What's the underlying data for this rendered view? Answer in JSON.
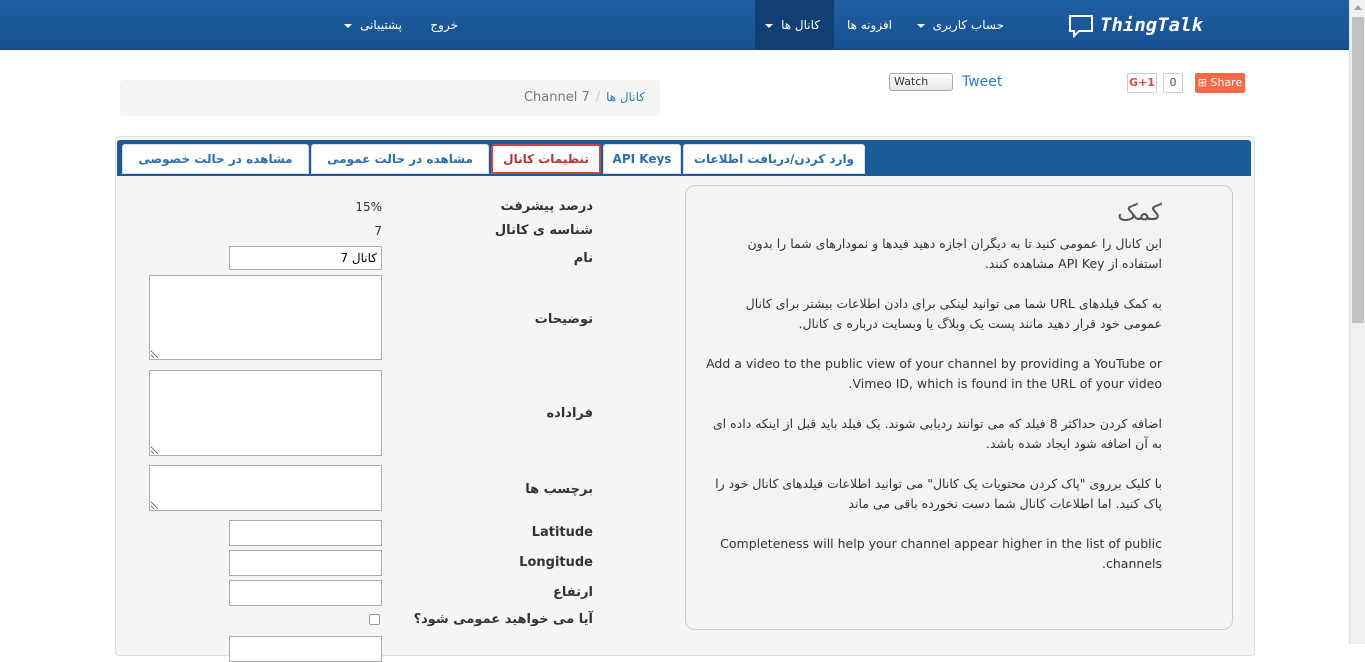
{
  "navbar": {
    "brand": "ThingTalk",
    "items": [
      {
        "label": "حساب کاربری",
        "dropdown": true
      },
      {
        "label": "افزونه ها",
        "dropdown": false
      },
      {
        "label": "کانال ها",
        "dropdown": true,
        "active": true
      },
      {
        "label": "خروج",
        "dropdown": false
      },
      {
        "label": "پشتیبانی",
        "dropdown": true
      }
    ]
  },
  "breadcrumb": {
    "link": "کانال ها",
    "separator": "/",
    "current": "Channel 7"
  },
  "social": {
    "watch": "Watch",
    "tweet": "Tweet",
    "gplus": "G+1",
    "gplus_count": "0",
    "share": "Share"
  },
  "tabs": [
    {
      "label": "وارد کردن/دریافت اطلاعات"
    },
    {
      "label": "API Keys"
    },
    {
      "label": "تنظیمات کانال",
      "active": true
    },
    {
      "label": "مشاهده در حالت عمومی"
    },
    {
      "label": "مشاهده در حالت خصوصی"
    }
  ],
  "help": {
    "title": "کمک",
    "paragraphs": [
      "این کانال را عمومی کنید تا به دیگران اجازه دهید فیدها و نمودارهای شما را بدون استفاده از API Key مشاهده کنند.",
      "به کمک فیلدهای URL شما می توانید لینکی برای دادن اطلاعات بیشتر برای کانال عمومی خود قرار دهید مانند پست یک وبلاگ یا وبسایت درباره ی کانال.",
      "Add a video to the public view of your channel by providing a YouTube or Vimeo ID, which is found in the URL of your video.",
      "اضافه کردن حداکثر 8 فیلد که می توانند ردیابی شوند. یک فیلد باید قبل از اینکه داده ای به آن اضافه شود ایجاد شده باشد.",
      "با کلیک برروی \"پاک کردن محتویات یک کانال\" می توانید اطلاعات فیلدهای کانال خود را پاک کنید. اما اطلاعات کانال شما دست نخورده باقی می ماند",
      "Completeness will help your channel appear higher in the list of public channels."
    ]
  },
  "form": {
    "progress_label": "درصد پیشرفت",
    "progress_value": "15%",
    "id_label": "شناسه ی کانال",
    "id_value": "7",
    "name_label": "نام",
    "name_value": "کانال 7",
    "description_label": "توضیحات",
    "description_value": "",
    "metadata_label": "فراداده",
    "metadata_value": "",
    "tags_label": "برچسب ها",
    "tags_value": "",
    "latitude_label": "Latitude",
    "latitude_value": "",
    "longitude_label": "Longitude",
    "longitude_value": "",
    "elevation_label": "ارتفاع",
    "elevation_value": "",
    "public_label": "آیا می خواهید عمومی شود؟",
    "public_checked": false
  }
}
